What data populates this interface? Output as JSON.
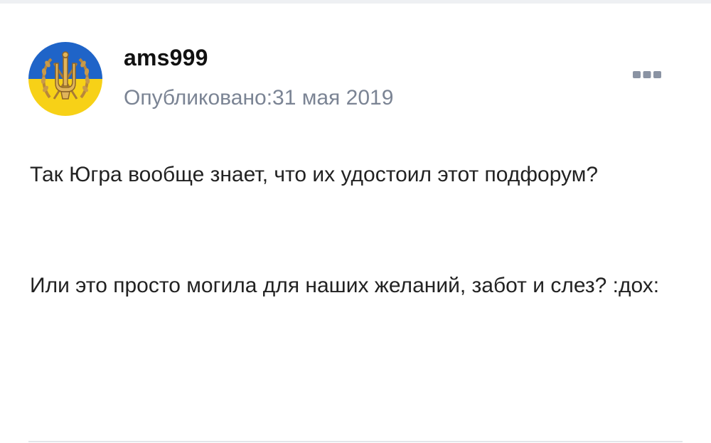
{
  "post": {
    "author": "ams999",
    "published_label": "Опубликовано:",
    "published_date": "31 мая 2019",
    "paragraphs": [
      "Так Югра вообще знает, что их удостоил этот подфорум?",
      "Или это просто могила для наших желаний, забот и слез? :дох:"
    ]
  },
  "icons": {
    "avatar": "trident-emblem-avatar",
    "more": "more-dots-icon"
  },
  "colors": {
    "avatar_blue": "#1f64c8",
    "avatar_yellow": "#f7d117",
    "meta_text": "#7b8494",
    "more_icon": "#8a93a3"
  }
}
